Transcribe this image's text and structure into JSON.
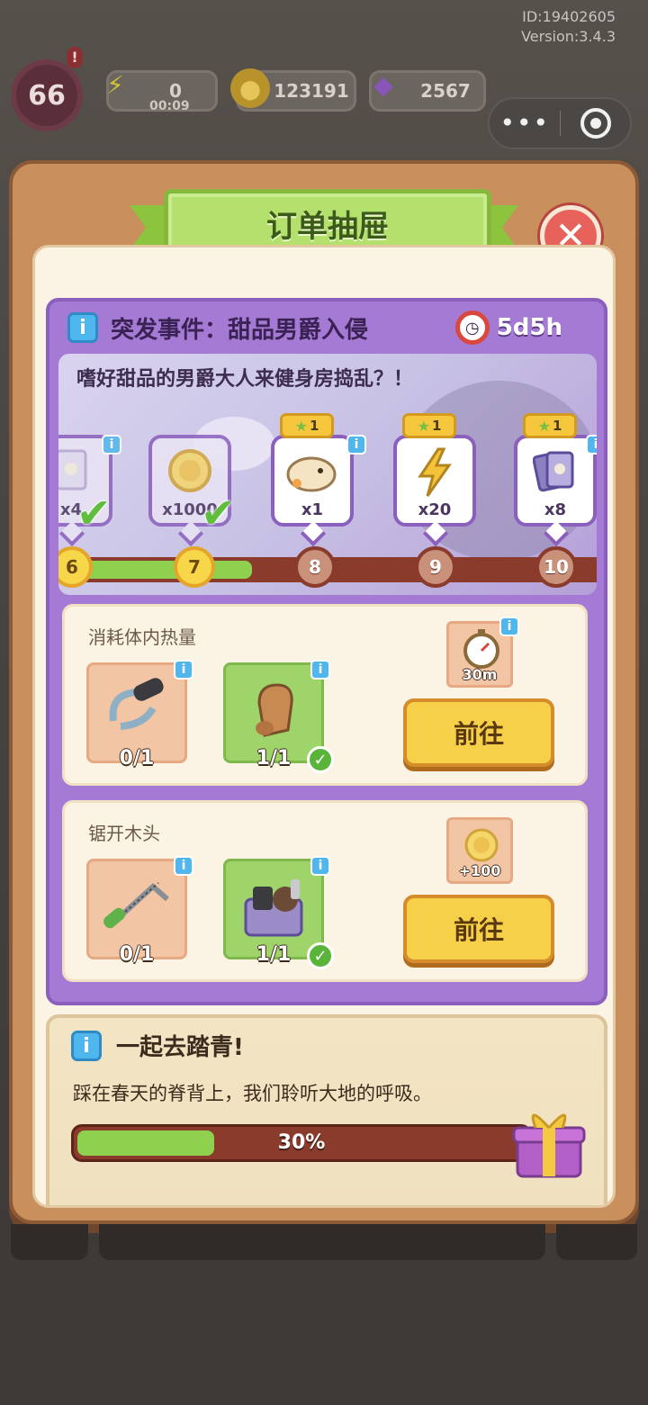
{
  "app_info": {
    "id_text": "ID:19402605",
    "version_text": "Version:3.4.3"
  },
  "hud": {
    "level": "66",
    "alert": "!",
    "energy": "0",
    "energy_timer": "00:09",
    "coins": "123191",
    "gems": "2567",
    "menu_dots": "•••"
  },
  "dialog": {
    "title": "订单抽屉",
    "close_label": "✕"
  },
  "event": {
    "info_label": "i",
    "title": "突发事件：甜品男爵入侵",
    "timer": "5d5h",
    "description": "嗜好甜品的男爵大人来健身房捣乱？！",
    "rewards": [
      {
        "qty": "x4",
        "claimed": true,
        "icon": "card-icon"
      },
      {
        "qty": "x1000",
        "claimed": true,
        "icon": "coin-icon"
      },
      {
        "qty": "x1",
        "claimed": false,
        "star": "1",
        "icon": "pet-icon"
      },
      {
        "qty": "x20",
        "claimed": false,
        "star": "1",
        "icon": "lightning-icon"
      },
      {
        "qty": "x8",
        "claimed": false,
        "star": "1",
        "icon": "cards-icon"
      }
    ],
    "nodes": [
      "6",
      "7",
      "8",
      "9",
      "10"
    ],
    "progress_fraction": 0.36
  },
  "tasks": [
    {
      "title": "消耗体内热量",
      "req1_count": "0/1",
      "req2_count": "1/1",
      "reward_text": "30m",
      "button": "前往"
    },
    {
      "title": "锯开木头",
      "req1_count": "0/1",
      "req2_count": "1/1",
      "reward_text": "+100",
      "button": "前往"
    }
  ],
  "spring": {
    "info_label": "i",
    "title": "一起去踏青!",
    "description": "踩在春天的脊背上，我们聆听大地的呼吸。",
    "progress_text": "30%",
    "progress_fraction": 0.3
  },
  "colors": {
    "accent_green": "#8ed14f",
    "event_purple": "#a57ad4",
    "button_yellow": "#f7d04a",
    "close_red": "#e7625a"
  }
}
